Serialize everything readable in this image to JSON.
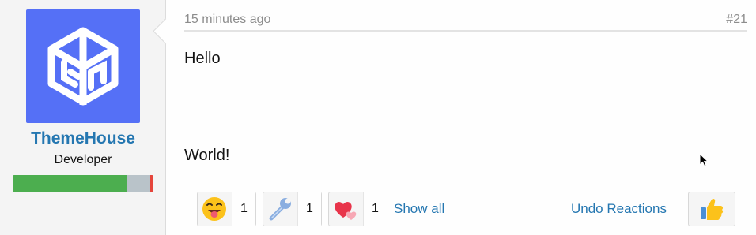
{
  "author": {
    "username": "ThemeHouse",
    "title": "Developer",
    "avatar_icon": "themehouse-logo-icon",
    "avatar_color": "#5570f6",
    "banner_colors": [
      "#4cae4f",
      "#b9c3c9",
      "#e5453b"
    ]
  },
  "post": {
    "time": "15 minutes ago",
    "number": "#21",
    "lines": [
      "Hello",
      "World!"
    ]
  },
  "reactions": [
    {
      "icon": "grinning-tongue-emoji-icon",
      "count": "1"
    },
    {
      "icon": "wrench-icon",
      "count": "1"
    },
    {
      "icon": "two-hearts-icon",
      "count": "1"
    }
  ],
  "actions": {
    "show_all": "Show all",
    "undo": "Undo Reactions",
    "like_icon": "thumbs-up-icon"
  },
  "colors": {
    "link": "#2577b1",
    "meta": "#8c8c8c"
  }
}
